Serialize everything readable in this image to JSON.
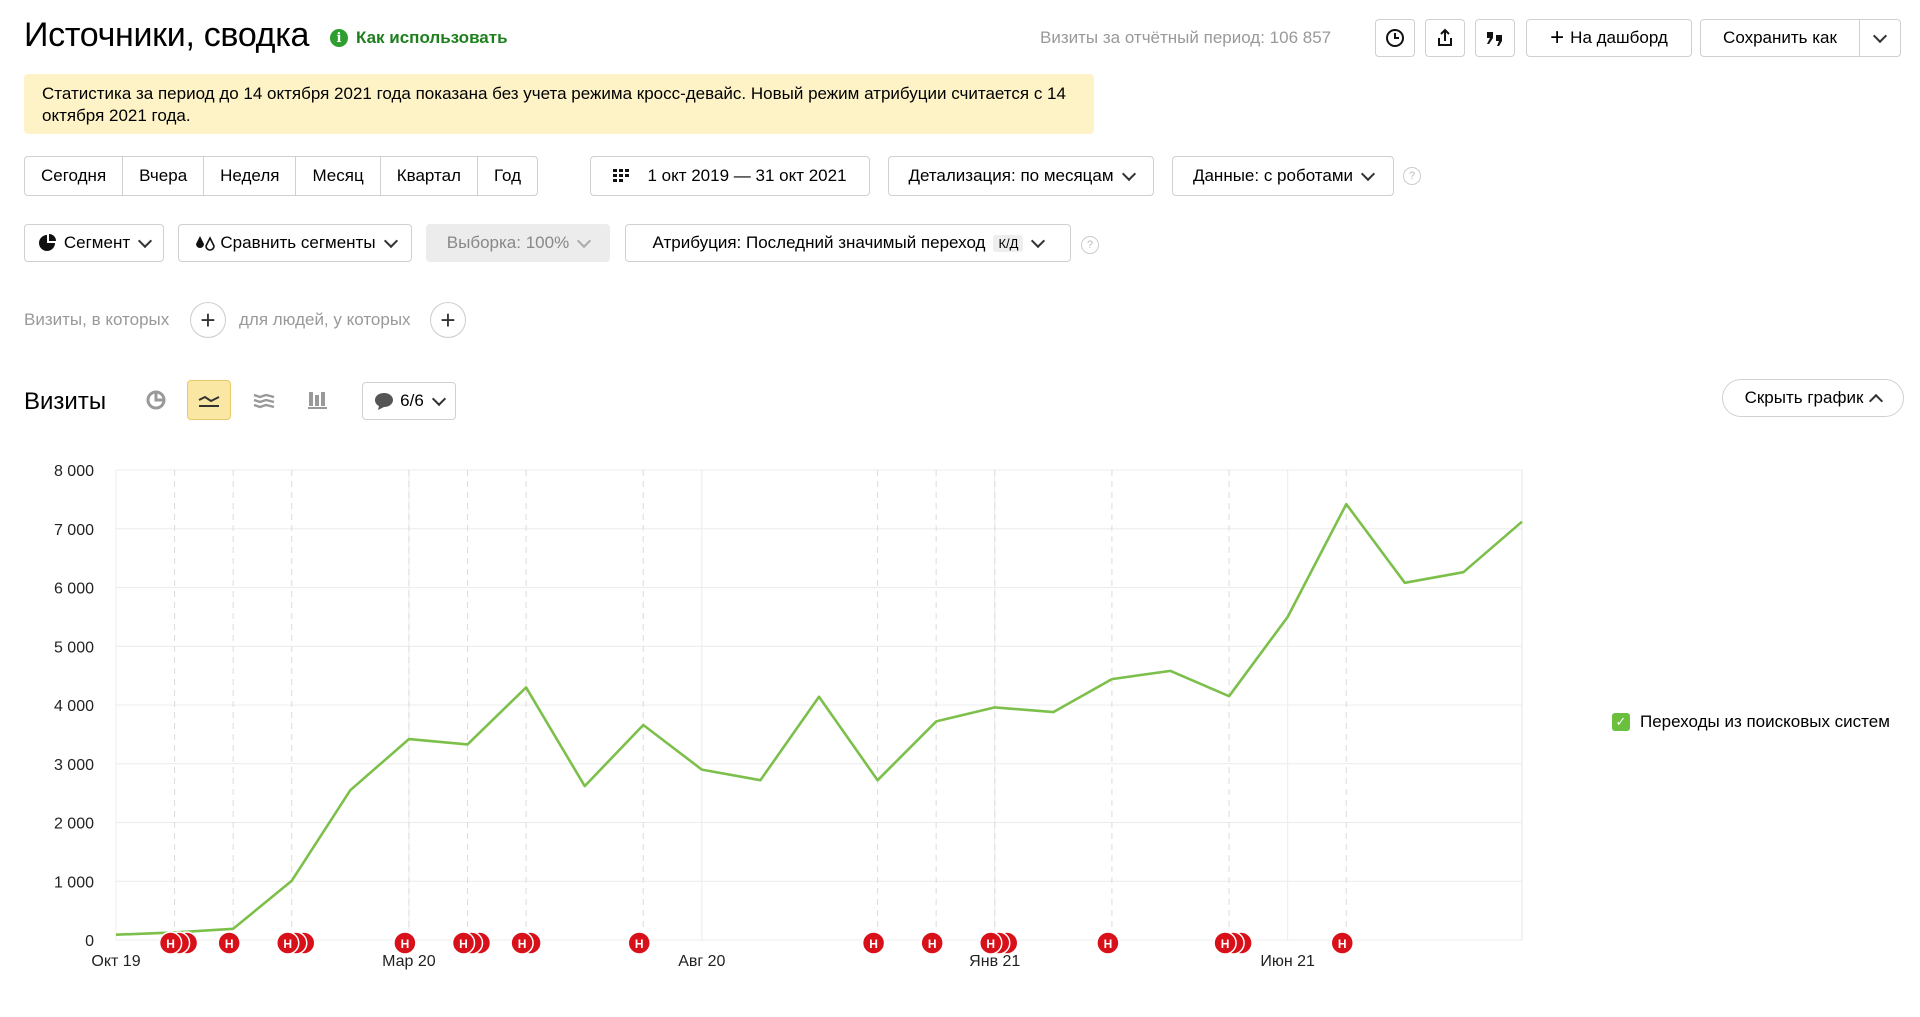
{
  "header": {
    "title": "Источники, сводка",
    "how_to_use": "Как использовать",
    "visits_total": "Визиты за отчётный период: 106 857",
    "add_dashboard": "На дашборд",
    "save_as": "Сохранить как"
  },
  "notice": "Статистика за период до 14 октября 2021 года показана без учета режима кросс-девайс. Новый режим атрибуции считается с 14 октября 2021 года.",
  "periods": [
    "Сегодня",
    "Вчера",
    "Неделя",
    "Месяц",
    "Квартал",
    "Год"
  ],
  "date_range": "1 окт 2019 — 31 окт 2021",
  "detail": "Детализация: по месяцам",
  "data_mode": "Данные: с роботами",
  "segment": "Сегмент",
  "compare_segments": "Сравнить сегменты",
  "sample": "Выборка: 100%",
  "attribution": "Атрибуция: Последний значимый переход",
  "attribution_badge": "К/Д",
  "filters": {
    "visits_where": "Визиты, в которых",
    "people_where": "для людей, у которых"
  },
  "chart_section": {
    "title": "Визиты",
    "annotations_count": "6/6",
    "hide_chart": "Скрыть график",
    "legend": "Переходы из поисковых систем",
    "colors": {
      "line": "#7cc04b",
      "annotation": "#d8101a"
    }
  },
  "chart_data": {
    "type": "line",
    "ylim": [
      0,
      8000
    ],
    "yticks": [
      "8 000",
      "7 000",
      "6 000",
      "5 000",
      "4 000",
      "3 000",
      "2 000",
      "1 000",
      "0"
    ],
    "xtick_labels": [
      {
        "index": 0,
        "label": "Окт 19"
      },
      {
        "index": 5,
        "label": "Мар 20"
      },
      {
        "index": 10,
        "label": "Авг 20"
      },
      {
        "index": 15,
        "label": "Янв 21"
      },
      {
        "index": 20,
        "label": "Июн 21"
      }
    ],
    "series": [
      {
        "name": "Переходы из поисковых систем",
        "values": [
          90,
          130,
          190,
          1010,
          2550,
          3420,
          3330,
          4300,
          2620,
          3660,
          2900,
          2720,
          4140,
          2720,
          3720,
          3960,
          3880,
          4440,
          4580,
          4150,
          5500,
          7420,
          6080,
          6260,
          7120
        ]
      }
    ],
    "annotations": [
      {
        "index": 1,
        "count": 3
      },
      {
        "index": 2,
        "count": 1
      },
      {
        "index": 3,
        "count": 3
      },
      {
        "index": 5,
        "count": 1
      },
      {
        "index": 6,
        "count": 3
      },
      {
        "index": 7,
        "count": 2
      },
      {
        "index": 9,
        "count": 1
      },
      {
        "index": 13,
        "count": 1
      },
      {
        "index": 14,
        "count": 1
      },
      {
        "index": 15,
        "count": 3
      },
      {
        "index": 17,
        "count": 1
      },
      {
        "index": 19,
        "count": 3
      },
      {
        "index": 21,
        "count": 1
      }
    ],
    "annotation_letter": "Н"
  }
}
